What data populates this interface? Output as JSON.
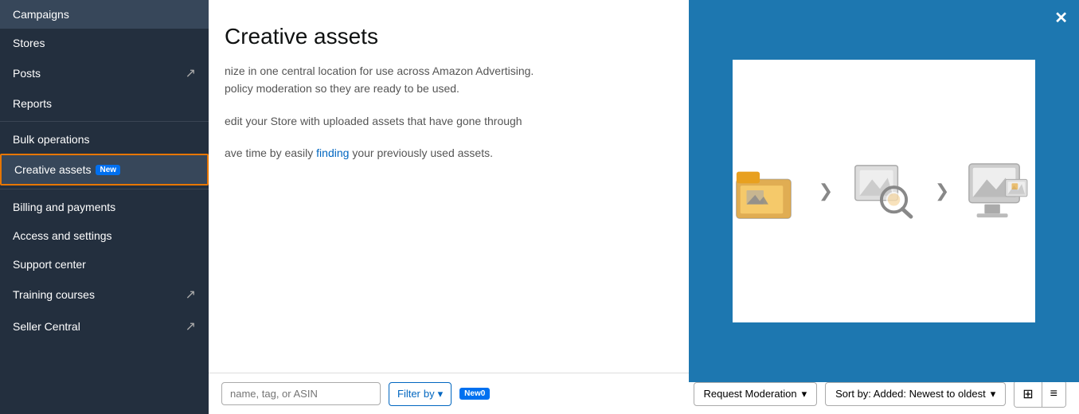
{
  "sidebar": {
    "items": [
      {
        "id": "campaigns",
        "label": "Campaigns",
        "external": false,
        "active": false,
        "dividerAfter": false
      },
      {
        "id": "stores",
        "label": "Stores",
        "external": false,
        "active": false,
        "dividerAfter": false
      },
      {
        "id": "posts",
        "label": "Posts",
        "external": true,
        "active": false,
        "dividerAfter": false
      },
      {
        "id": "reports",
        "label": "Reports",
        "external": false,
        "active": false,
        "dividerAfter": true
      },
      {
        "id": "bulk-operations",
        "label": "Bulk operations",
        "external": false,
        "active": false,
        "dividerAfter": false
      },
      {
        "id": "creative-assets",
        "label": "Creative assets",
        "external": false,
        "active": true,
        "badge": "New",
        "dividerAfter": true
      },
      {
        "id": "billing-payments",
        "label": "Billing and payments",
        "external": false,
        "active": false,
        "dividerAfter": false
      },
      {
        "id": "access-settings",
        "label": "Access and settings",
        "external": false,
        "active": false,
        "dividerAfter": false
      },
      {
        "id": "support-center",
        "label": "Support center",
        "external": false,
        "active": false,
        "dividerAfter": false
      },
      {
        "id": "training-courses",
        "label": "Training courses",
        "external": true,
        "active": false,
        "dividerAfter": false
      },
      {
        "id": "seller-central",
        "label": "Seller Central",
        "external": true,
        "active": false,
        "dividerAfter": false
      }
    ]
  },
  "main": {
    "title": "Creative assets",
    "description_line1": "nize in one central location for use across Amazon Advertising.",
    "description_line2": "policy moderation so they are ready to be used.",
    "description_line3": "edit your Store with uploaded assets that have gone through",
    "description_line4": "ave time by easily finding your previously used assets.",
    "highlight1": "finding",
    "bottom_bar": {
      "search_placeholder": "name, tag, or ASIN",
      "filter_label": "Filter",
      "filter_suffix": "by",
      "new_badge": "New",
      "new_count": "0",
      "request_moderation": "Request Moderation",
      "sort_label": "Sort by: Added: Newest to oldest"
    }
  }
}
